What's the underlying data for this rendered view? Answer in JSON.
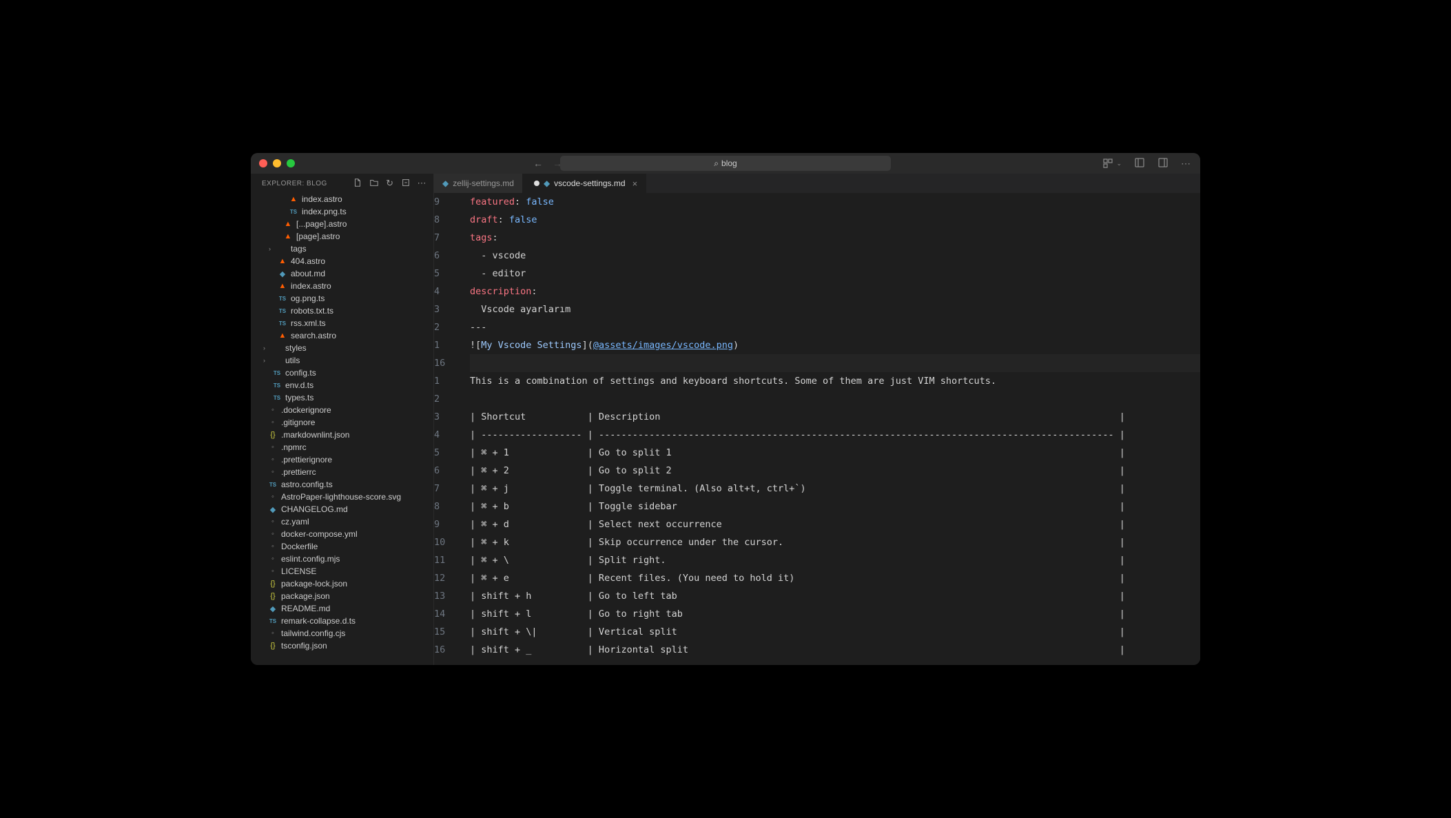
{
  "titlebar": {
    "search": "blog"
  },
  "explorer": {
    "title": "EXPLORER: BLOG",
    "files": [
      {
        "name": "index.astro",
        "icon": "astro",
        "indent": 42
      },
      {
        "name": "index.png.ts",
        "icon": "ts",
        "indent": 42
      },
      {
        "name": "[...page].astro",
        "icon": "astro",
        "indent": 34
      },
      {
        "name": "[page].astro",
        "icon": "astro",
        "indent": 34
      },
      {
        "name": "tags",
        "icon": "folder",
        "indent": 26,
        "chevron": true
      },
      {
        "name": "404.astro",
        "icon": "astro",
        "indent": 26
      },
      {
        "name": "about.md",
        "icon": "md",
        "indent": 26
      },
      {
        "name": "index.astro",
        "icon": "astro",
        "indent": 26
      },
      {
        "name": "og.png.ts",
        "icon": "ts",
        "indent": 26
      },
      {
        "name": "robots.txt.ts",
        "icon": "ts",
        "indent": 26
      },
      {
        "name": "rss.xml.ts",
        "icon": "ts",
        "indent": 26
      },
      {
        "name": "search.astro",
        "icon": "astro",
        "indent": 26
      },
      {
        "name": "styles",
        "icon": "folder",
        "indent": 18,
        "chevron": true
      },
      {
        "name": "utils",
        "icon": "folder",
        "indent": 18,
        "chevron": true
      },
      {
        "name": "config.ts",
        "icon": "ts",
        "indent": 18
      },
      {
        "name": "env.d.ts",
        "icon": "ts",
        "indent": 18
      },
      {
        "name": "types.ts",
        "icon": "ts",
        "indent": 18
      },
      {
        "name": ".dockerignore",
        "icon": "gray",
        "indent": 12
      },
      {
        "name": ".gitignore",
        "icon": "gray",
        "indent": 12
      },
      {
        "name": ".markdownlint.json",
        "icon": "json",
        "indent": 12
      },
      {
        "name": ".npmrc",
        "icon": "gray",
        "indent": 12
      },
      {
        "name": ".prettierignore",
        "icon": "gray",
        "indent": 12
      },
      {
        "name": ".prettierrc",
        "icon": "gray",
        "indent": 12
      },
      {
        "name": "astro.config.ts",
        "icon": "ts",
        "indent": 12
      },
      {
        "name": "AstroPaper-lighthouse-score.svg",
        "icon": "gray",
        "indent": 12
      },
      {
        "name": "CHANGELOG.md",
        "icon": "md",
        "indent": 12
      },
      {
        "name": "cz.yaml",
        "icon": "gray",
        "indent": 12
      },
      {
        "name": "docker-compose.yml",
        "icon": "gray",
        "indent": 12
      },
      {
        "name": "Dockerfile",
        "icon": "gray",
        "indent": 12
      },
      {
        "name": "eslint.config.mjs",
        "icon": "gray",
        "indent": 12
      },
      {
        "name": "LICENSE",
        "icon": "gray",
        "indent": 12
      },
      {
        "name": "package-lock.json",
        "icon": "json",
        "indent": 12
      },
      {
        "name": "package.json",
        "icon": "json",
        "indent": 12
      },
      {
        "name": "README.md",
        "icon": "md",
        "indent": 12
      },
      {
        "name": "remark-collapse.d.ts",
        "icon": "ts",
        "indent": 12
      },
      {
        "name": "tailwind.config.cjs",
        "icon": "gray",
        "indent": 12
      },
      {
        "name": "tsconfig.json",
        "icon": "json",
        "indent": 12
      }
    ]
  },
  "tabs": [
    {
      "label": "zellij-settings.md",
      "active": false,
      "dirty": true
    },
    {
      "label": "vscode-settings.md",
      "active": true,
      "dirty": true
    }
  ],
  "editor": {
    "gutters": [
      "9",
      "8",
      "7",
      "6",
      "5",
      "4",
      "3",
      "2",
      "1",
      "16",
      "1",
      "2",
      "3",
      "4",
      "5",
      "6",
      "7",
      "8",
      "9",
      "10",
      "11",
      "12",
      "13",
      "14",
      "15",
      "16"
    ],
    "lines": [
      {
        "type": "yaml",
        "key": "featured",
        "sep": ": ",
        "val": "false"
      },
      {
        "type": "yaml",
        "key": "draft",
        "sep": ": ",
        "val": "false"
      },
      {
        "type": "yaml",
        "key": "tags",
        "sep": ":"
      },
      {
        "type": "plain",
        "text": "  - vscode"
      },
      {
        "type": "plain",
        "text": "  - editor"
      },
      {
        "type": "yaml",
        "key": "description",
        "sep": ":"
      },
      {
        "type": "plain",
        "text": "  Vscode ayarlarım"
      },
      {
        "type": "plain",
        "text": "---"
      },
      {
        "type": "imglink",
        "pre": "![",
        "alt": "My Vscode Settings",
        "mid": "](",
        "url": "@assets/images/vscode.png",
        "post": ")"
      },
      {
        "type": "plain",
        "text": "",
        "current": true
      },
      {
        "type": "plain",
        "text": "This is a combination of settings and keyboard shortcuts. Some of them are just VIM shortcuts."
      },
      {
        "type": "plain",
        "text": ""
      },
      {
        "type": "table",
        "col1": "Shortcut",
        "col2": "Description"
      },
      {
        "type": "tablesep"
      },
      {
        "type": "table",
        "col1": "⌘ + 1",
        "col2": "Go to split 1"
      },
      {
        "type": "table",
        "col1": "⌘ + 2",
        "col2": "Go to split 2"
      },
      {
        "type": "table",
        "col1": "⌘ + j",
        "col2": "Toggle terminal. (Also alt+t, ctrl+`)"
      },
      {
        "type": "table",
        "col1": "⌘ + b",
        "col2": "Toggle sidebar"
      },
      {
        "type": "table",
        "col1": "⌘ + d",
        "col2": "Select next occurrence"
      },
      {
        "type": "table",
        "col1": "⌘ + k",
        "col2": "Skip occurrence under the cursor."
      },
      {
        "type": "table",
        "col1": "⌘ + \\",
        "col2": "Split right."
      },
      {
        "type": "table",
        "col1": "⌘ + e",
        "col2": "Recent files. (You need to hold it)"
      },
      {
        "type": "table",
        "col1": "shift + h",
        "col2": "Go to left tab"
      },
      {
        "type": "table",
        "col1": "shift + l",
        "col2": "Go to right tab"
      },
      {
        "type": "table",
        "col1": "shift + \\|",
        "col2": "Vertical split"
      },
      {
        "type": "table",
        "col1": "shift + _",
        "col2": "Horizontal split"
      }
    ],
    "table_col1_width": 18,
    "table_col2_width": 92
  }
}
